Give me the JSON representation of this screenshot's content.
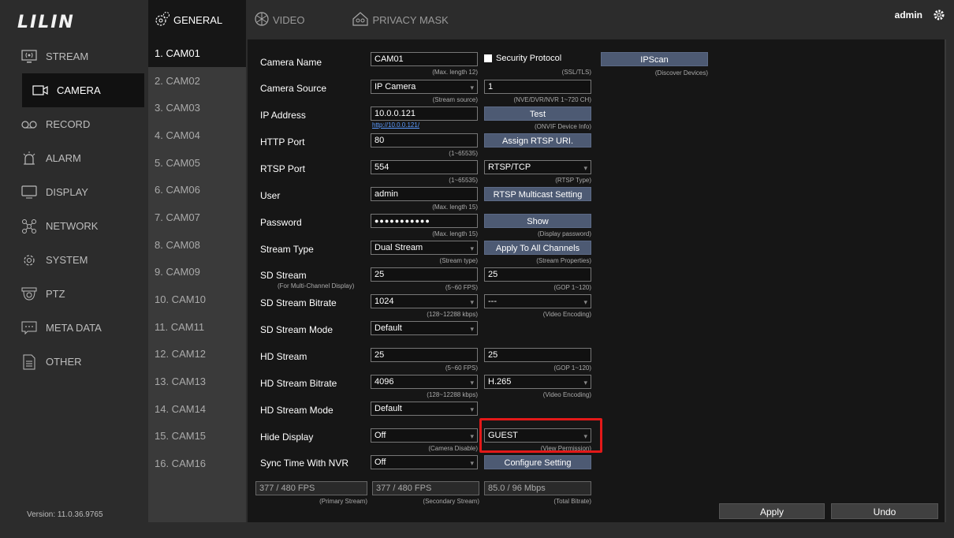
{
  "logo": "LILIN",
  "version": "Version: 11.0.36.9765",
  "user": "admin",
  "nav": [
    {
      "label": "STREAM",
      "icon": "stream-icon"
    },
    {
      "label": "CAMERA",
      "icon": "camera-icon"
    },
    {
      "label": "RECORD",
      "icon": "record-icon"
    },
    {
      "label": "ALARM",
      "icon": "alarm-icon"
    },
    {
      "label": "DISPLAY",
      "icon": "display-icon"
    },
    {
      "label": "NETWORK",
      "icon": "network-icon"
    },
    {
      "label": "SYSTEM",
      "icon": "system-icon"
    },
    {
      "label": "PTZ",
      "icon": "ptz-icon"
    },
    {
      "label": "META DATA",
      "icon": "meta-data-icon"
    },
    {
      "label": "OTHER",
      "icon": "other-icon"
    }
  ],
  "tabs": [
    {
      "label": "GENERAL",
      "icon": "gear-tab-icon"
    },
    {
      "label": "VIDEO",
      "icon": "video-icon"
    },
    {
      "label": "PRIVACY MASK",
      "icon": "privacy-mask-icon"
    }
  ],
  "cams": [
    "1. CAM01",
    "2. CAM02",
    "3. CAM03",
    "4. CAM04",
    "5. CAM05",
    "6. CAM06",
    "7. CAM07",
    "8. CAM08",
    "9. CAM09",
    "10. CAM10",
    "11. CAM11",
    "12. CAM12",
    "13. CAM13",
    "14. CAM14",
    "15. CAM15",
    "16. CAM16"
  ],
  "form": {
    "camera_name": {
      "label": "Camera Name",
      "value": "CAM01",
      "hint": "(Max. length 12)"
    },
    "security": {
      "label": "Security Protocol",
      "hint": "(SSL/TLS)"
    },
    "ipscan": {
      "label": "IPScan",
      "hint": "(Discover Devices)"
    },
    "camera_source": {
      "label": "Camera Source",
      "value": "IP Camera",
      "hint": "(Stream source)",
      "ch": "1",
      "ch_hint": "(NVE/DVR/NVR 1~720 CH)"
    },
    "ip_address": {
      "label": "IP Address",
      "value": "10.0.0.121",
      "link": "http://10.0.0.121/",
      "test": "Test",
      "test_hint": "(ONVIF Device Info)"
    },
    "http_port": {
      "label": "HTTP Port",
      "value": "80",
      "hint": "(1~65535)",
      "assign": "Assign RTSP URI."
    },
    "rtsp_port": {
      "label": "RTSP Port",
      "value": "554",
      "hint": "(1~65535)",
      "type": "RTSP/TCP",
      "type_hint": "(RTSP Type)"
    },
    "user": {
      "label": "User",
      "value": "admin",
      "hint": "(Max. length 15)",
      "multicast": "RTSP Multicast Setting"
    },
    "password": {
      "label": "Password",
      "value": "●●●●●●●●●●●",
      "hint": "(Max. length 15)",
      "show": "Show",
      "show_hint": "(Display password)"
    },
    "stream_type": {
      "label": "Stream Type",
      "value": "Dual Stream",
      "hint": "(Stream type)",
      "apply_all": "Apply To All Channels",
      "apply_hint": "(Stream Properties)"
    },
    "sd_stream": {
      "label": "SD Stream",
      "sub": "(For Multi-Channel Display)",
      "value": "25",
      "hint": "(5~60 FPS)",
      "gop": "25",
      "gop_hint": "(GOP 1~120)"
    },
    "sd_bitrate": {
      "label": "SD Stream Bitrate",
      "value": "1024",
      "hint": "(128~12288 kbps)",
      "enc": "---",
      "enc_hint": "(Video Encoding)"
    },
    "sd_mode": {
      "label": "SD Stream Mode",
      "value": "Default"
    },
    "hd_stream": {
      "label": "HD Stream",
      "value": "25",
      "hint": "(5~60 FPS)",
      "gop": "25",
      "gop_hint": "(GOP 1~120)"
    },
    "hd_bitrate": {
      "label": "HD Stream Bitrate",
      "value": "4096",
      "hint": "(128~12288 kbps)",
      "enc": "H.265",
      "enc_hint": "(Video Encoding)"
    },
    "hd_mode": {
      "label": "HD Stream Mode",
      "value": "Default"
    },
    "hide_display": {
      "label": "Hide Display",
      "value": "Off",
      "hint": "(Camera Disable)",
      "perm": "GUEST",
      "perm_hint": "(View Permission)"
    },
    "sync_time": {
      "label": "Sync Time With NVR",
      "value": "Off",
      "configure": "Configure Setting"
    },
    "stats": [
      {
        "value": "377 / 480 FPS",
        "hint": "(Primary Stream)"
      },
      {
        "value": "377 / 480 FPS",
        "hint": "(Secondary Stream)"
      },
      {
        "value": "85.0 / 96 Mbps",
        "hint": "(Total Bitrate)"
      }
    ]
  },
  "footer": {
    "apply": "Apply",
    "undo": "Undo"
  }
}
